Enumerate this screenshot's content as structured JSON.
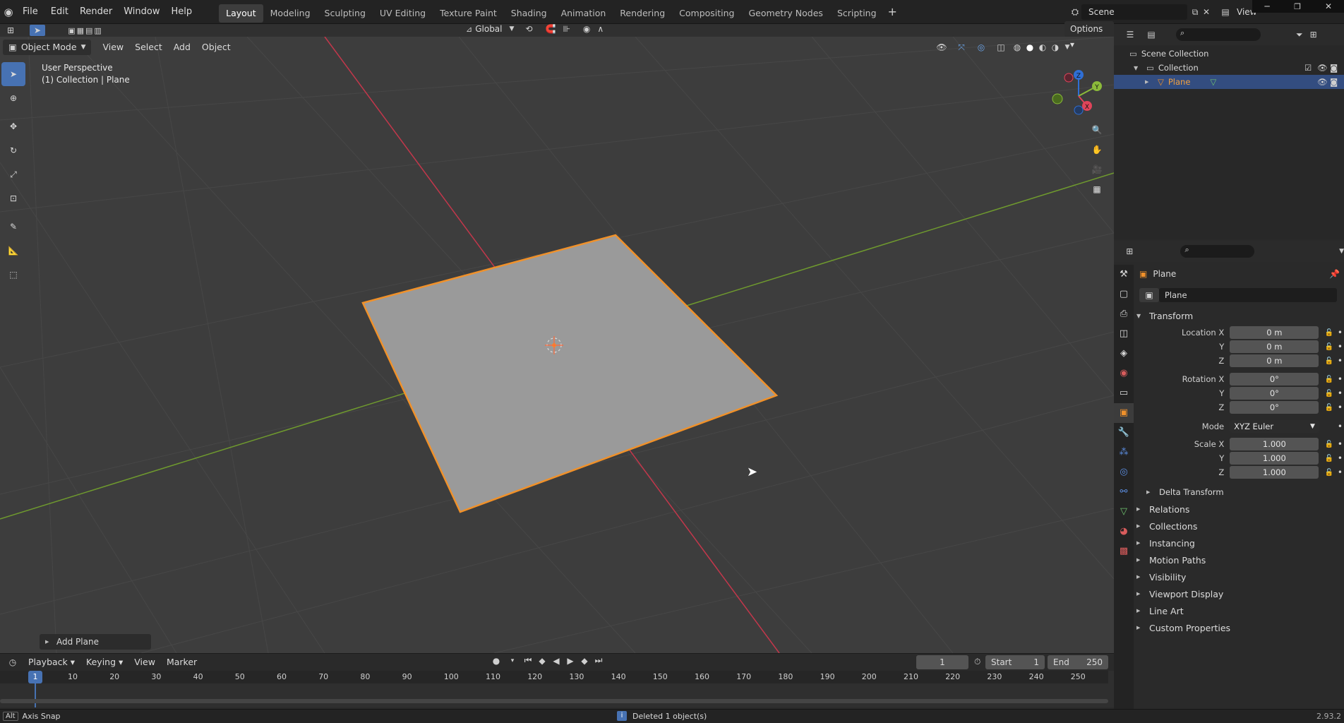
{
  "topbar": {
    "menus": [
      "File",
      "Edit",
      "Render",
      "Window",
      "Help"
    ],
    "workspaces": [
      "Layout",
      "Modeling",
      "Sculpting",
      "UV Editing",
      "Texture Paint",
      "Shading",
      "Animation",
      "Rendering",
      "Compositing",
      "Geometry Nodes",
      "Scripting"
    ],
    "active_workspace": "Layout",
    "scene": "Scene",
    "view_layer": "View"
  },
  "viewport": {
    "mode": "Object Mode",
    "menus": [
      "View",
      "Select",
      "Add",
      "Object"
    ],
    "orientation": "Global",
    "options_label": "Options",
    "info_line1": "User Perspective",
    "info_line2": "(1) Collection | Plane",
    "last_op": "Add Plane",
    "axis_labels": {
      "x": "X",
      "y": "Y",
      "z": "Z"
    }
  },
  "outliner": {
    "scene_collection": "Scene Collection",
    "collection": "Collection",
    "object": "Plane"
  },
  "properties": {
    "object_name": "Plane",
    "object_field": "Plane",
    "transform_title": "Transform",
    "location": {
      "label_x": "Location X",
      "label_y": "Y",
      "label_z": "Z",
      "x": "0 m",
      "y": "0 m",
      "z": "0 m"
    },
    "rotation": {
      "label_x": "Rotation X",
      "label_y": "Y",
      "label_z": "Z",
      "x": "0°",
      "y": "0°",
      "z": "0°"
    },
    "mode_label": "Mode",
    "mode_value": "XYZ Euler",
    "scale": {
      "label_x": "Scale X",
      "label_y": "Y",
      "label_z": "Z",
      "x": "1.000",
      "y": "1.000",
      "z": "1.000"
    },
    "delta": "Delta Transform",
    "panels": [
      "Relations",
      "Collections",
      "Instancing",
      "Motion Paths",
      "Visibility",
      "Viewport Display",
      "Line Art",
      "Custom Properties"
    ]
  },
  "timeline": {
    "menus": [
      "Playback",
      "Keying",
      "View",
      "Marker"
    ],
    "current_frame": "1",
    "start_label": "Start",
    "start": "1",
    "end_label": "End",
    "end": "250",
    "ruler": [
      "10",
      "20",
      "30",
      "40",
      "50",
      "60",
      "70",
      "80",
      "90",
      "100",
      "110",
      "120",
      "130",
      "140",
      "150",
      "160",
      "170",
      "180",
      "190",
      "200",
      "210",
      "220",
      "230",
      "240",
      "250"
    ]
  },
  "statusbar": {
    "key": "Alt",
    "hint": "Axis Snap",
    "message": "Deleted 1 object(s)",
    "version": "2.93.2"
  },
  "colors": {
    "accent": "#4772b3",
    "selected": "#f0912a",
    "x_axis": "#c3374b",
    "y_axis": "#6f9a2e"
  }
}
